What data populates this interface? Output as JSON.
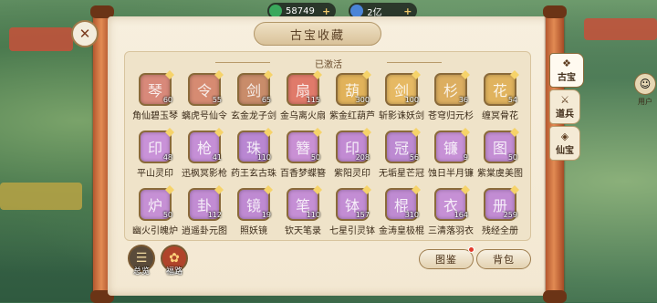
{
  "resources": [
    {
      "name": "jade",
      "value": "58749",
      "icon": "jade-coin-icon",
      "color": "#3aa85c"
    },
    {
      "name": "gem",
      "value": "2亿",
      "icon": "spirit-gem-icon",
      "color": "#4a84d8"
    }
  ],
  "window": {
    "title": "古宝收藏",
    "section_label": "已激活"
  },
  "items": [
    {
      "name": "角仙碧玉琴",
      "level": "60",
      "color": "#d8897a",
      "glyph": "琴"
    },
    {
      "name": "螭虎号仙令",
      "level": "55",
      "color": "#d68b72",
      "glyph": "令"
    },
    {
      "name": "玄金龙子剑",
      "level": "65",
      "color": "#c98c6a",
      "glyph": "剑"
    },
    {
      "name": "金乌离火扇",
      "level": "115",
      "color": "#e07a6a",
      "glyph": "扇"
    },
    {
      "name": "紫金红葫芦",
      "level": "300",
      "color": "#e1b25a",
      "glyph": "葫"
    },
    {
      "name": "斩影诛妖剑",
      "level": "100",
      "color": "#e6b963",
      "glyph": "剑"
    },
    {
      "name": "苍穹归元杉",
      "level": "36",
      "color": "#dcae60",
      "glyph": "杉"
    },
    {
      "name": "缠冥骨花",
      "level": "54",
      "color": "#e0b35e",
      "glyph": "花"
    },
    {
      "name": "平山灵印",
      "level": "48",
      "color": "#c992d8",
      "glyph": "印"
    },
    {
      "name": "迅枫冥影枪",
      "level": "41",
      "color": "#c58fd6",
      "glyph": "枪"
    },
    {
      "name": "药王玄古珠",
      "level": "110",
      "color": "#b987d2",
      "glyph": "珠"
    },
    {
      "name": "百香梦蝶簪",
      "level": "50",
      "color": "#c990d4",
      "glyph": "簪"
    },
    {
      "name": "紫阳灵印",
      "level": "208",
      "color": "#c28bd3",
      "glyph": "印"
    },
    {
      "name": "无垢星芒冠",
      "level": "56",
      "color": "#bd8ad2",
      "glyph": "冠"
    },
    {
      "name": "蚀日半月镰",
      "level": "9",
      "color": "#c791d6",
      "glyph": "镰"
    },
    {
      "name": "紫棠虞美图",
      "level": "50",
      "color": "#c48ed4",
      "glyph": "图"
    },
    {
      "name": "幽火引魄炉",
      "level": "50",
      "color": "#c690d5",
      "glyph": "炉"
    },
    {
      "name": "逍遥卦元图",
      "level": "112",
      "color": "#c28cd3",
      "glyph": "卦"
    },
    {
      "name": "照妖镜",
      "level": "19",
      "color": "#bf8ad2",
      "glyph": "镜"
    },
    {
      "name": "钦天笔录",
      "level": "110",
      "color": "#c58fd5",
      "glyph": "笔"
    },
    {
      "name": "七星引灵钵",
      "level": "157",
      "color": "#c38dd4",
      "glyph": "钵"
    },
    {
      "name": "金涛皇极棍",
      "level": "310",
      "color": "#bf8bd2",
      "glyph": "棍"
    },
    {
      "name": "三清落羽衣",
      "level": "164",
      "color": "#c690d5",
      "glyph": "衣"
    },
    {
      "name": "残经全册",
      "level": "259",
      "color": "#c28cd3",
      "glyph": "册"
    }
  ],
  "tabs": [
    {
      "label": "古宝",
      "glyph": "❖",
      "active": true
    },
    {
      "label": "道兵",
      "glyph": "⚔",
      "active": false
    },
    {
      "label": "仙宝",
      "glyph": "◈",
      "active": false
    }
  ],
  "side": {
    "user_center": "用户"
  },
  "bottom": {
    "overview_label": "总览",
    "fortune_label": "福路",
    "codex_label": "图鉴",
    "bag_label": "背包"
  }
}
